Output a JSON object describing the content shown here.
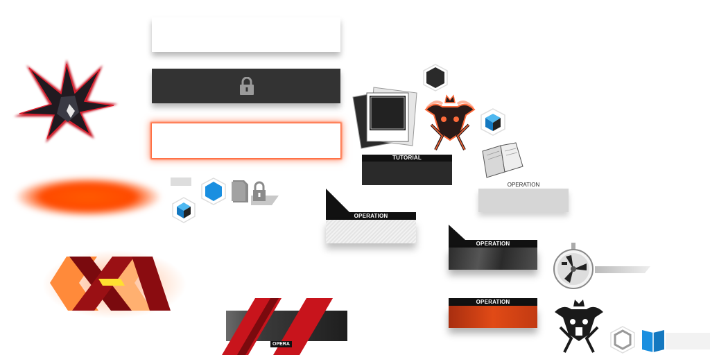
{
  "labels": {
    "tutorial": "TUTORIAL",
    "operation_plain": "OPERATION",
    "operation_white": "OPERATION",
    "operation_dark": "OPERATION",
    "operation_orange": "OPERATION",
    "operation_small": "OPERA"
  },
  "icons": {
    "burst": "red-crystal-burst-icon",
    "lock": "lock-icon",
    "hex_dark": "hexagon-icon",
    "cube": "cube-icon",
    "bull_skull": "bull-skull-emblem-icon",
    "book": "book-icon",
    "photos": "photo-stack-icon",
    "fan": "fan-dial-icon"
  },
  "colors": {
    "accent_orange": "#ff5a00",
    "accent_red": "#c8141c",
    "accent_blue": "#1a8fe0",
    "panel_dark": "#333333"
  }
}
